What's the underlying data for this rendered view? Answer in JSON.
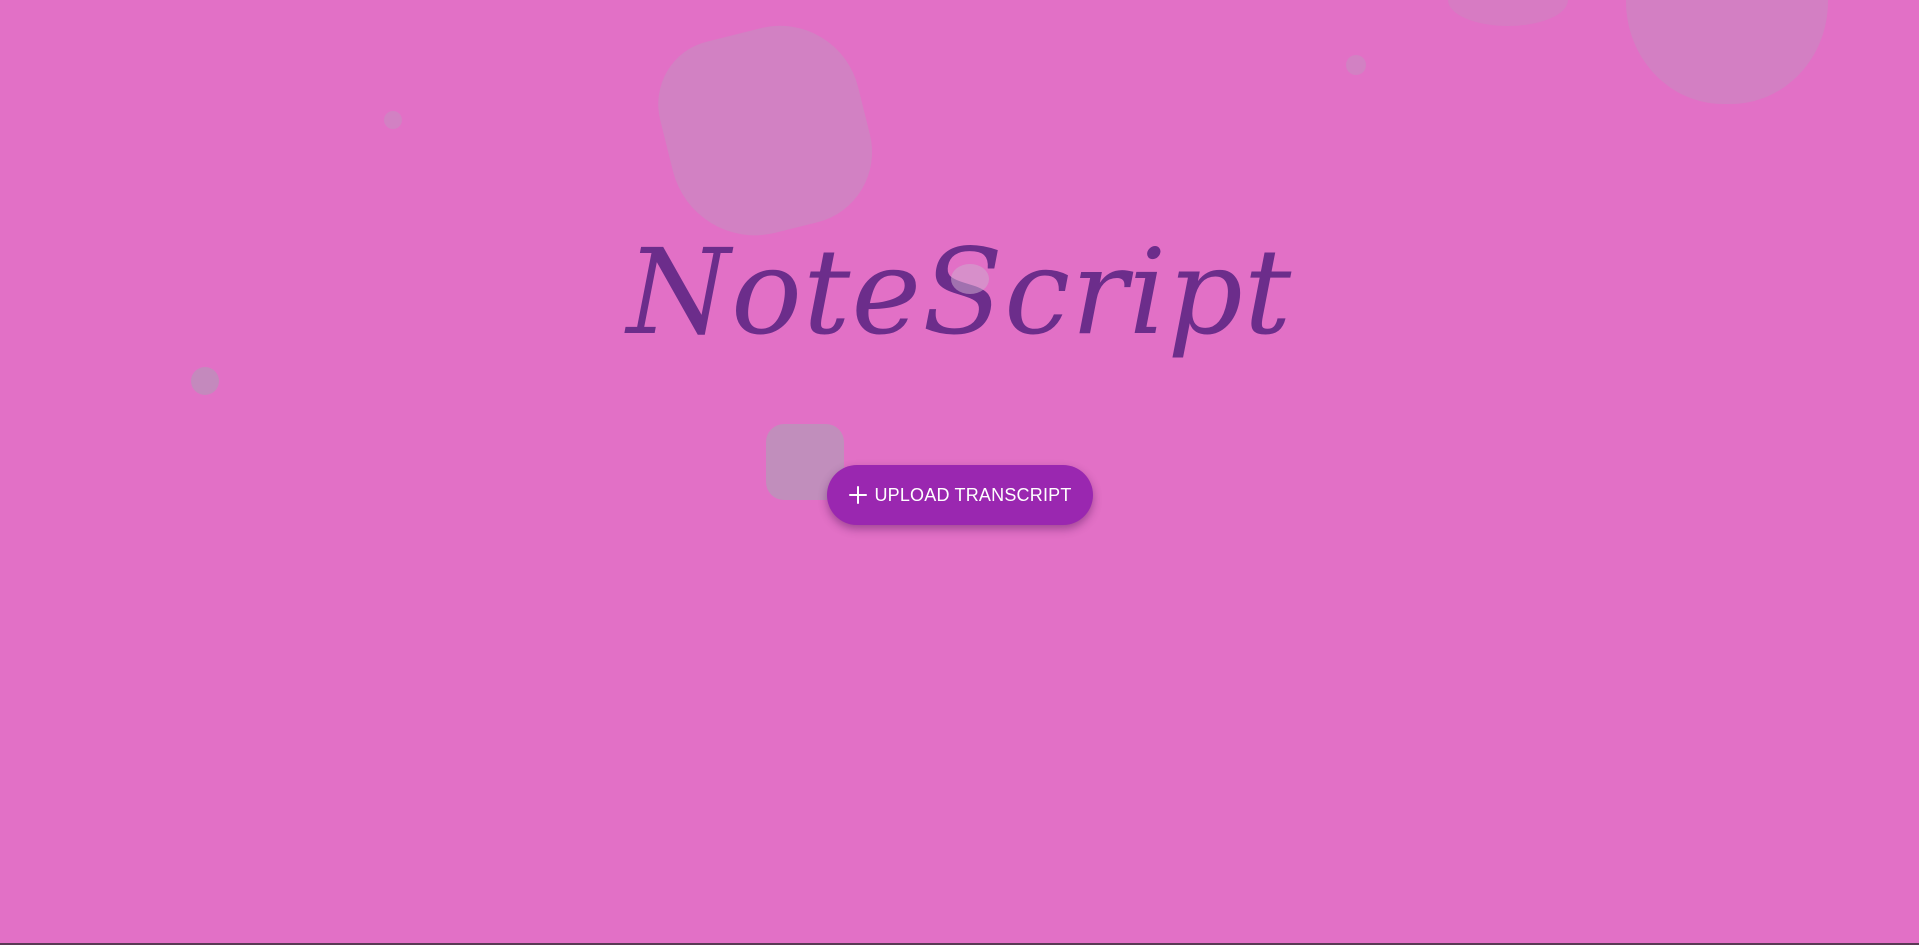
{
  "app": {
    "title": "NoteScript"
  },
  "actions": {
    "upload_label": "UPLOAD TRANSCRIPT",
    "upload_icon": "plus-icon"
  },
  "colors": {
    "background": "#e270c6",
    "title": "#6c2d8b",
    "button": "#9a27b0",
    "button_text": "#ffffff"
  }
}
